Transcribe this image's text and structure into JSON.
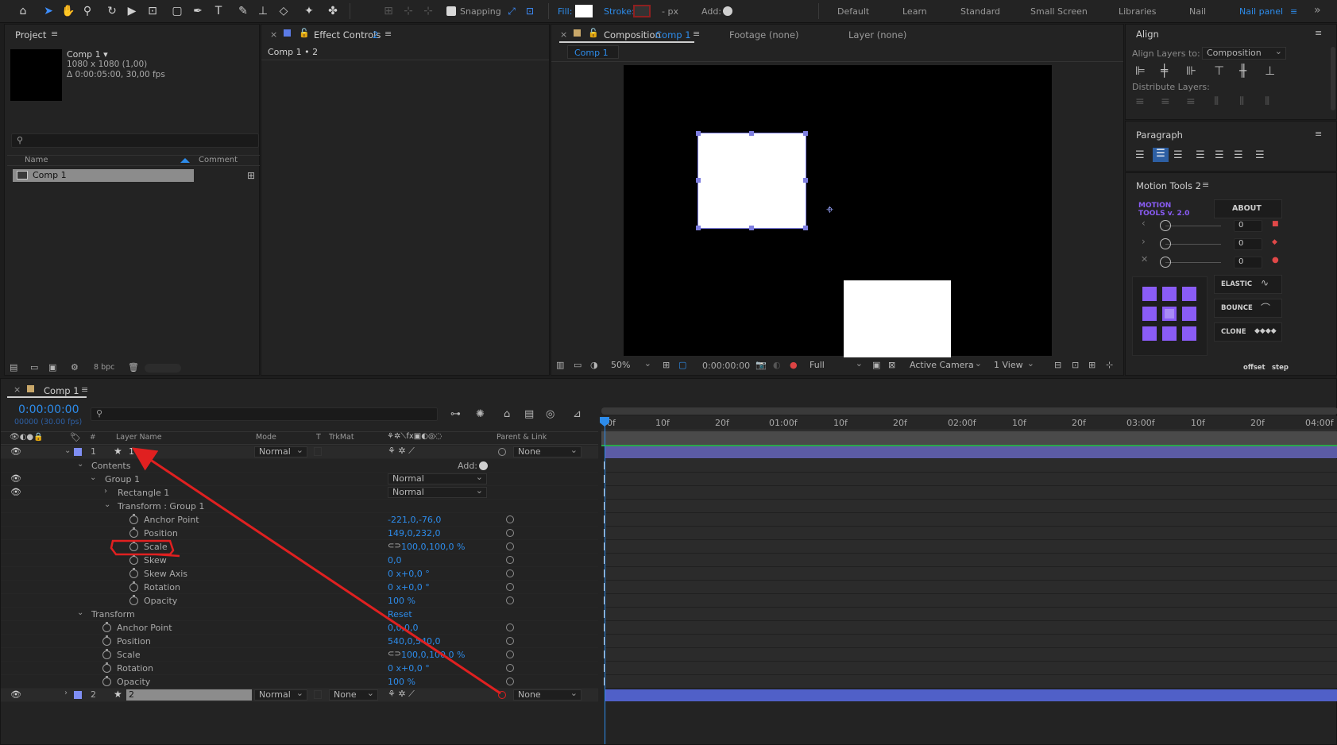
{
  "toolbar": {
    "snapping": "Snapping",
    "fill": "Fill:",
    "stroke": "Stroke:",
    "px": "- px",
    "add": "Add:",
    "workspaces": [
      "Default",
      "Learn",
      "Standard",
      "Small Screen",
      "Libraries",
      "Nail",
      "Nail panel"
    ],
    "more": "»"
  },
  "project": {
    "title": "Project",
    "comp_name": "Comp 1 ▾",
    "comp_size": "1080 x 1080 (1,00)",
    "comp_duration": "Δ 0:00:05:00, 30,00 fps",
    "search_placeholder": "",
    "col_name": "Name",
    "col_comment": "Comment",
    "item": "Comp 1",
    "bpc": "8 bpc"
  },
  "effects": {
    "title": "Effect Controls",
    "num": "2",
    "sub": "Comp 1 • 2"
  },
  "composition": {
    "tab_label": "Composition",
    "tab_name": "Comp 1",
    "footage": "Footage (none)",
    "layer": "Layer (none)",
    "subtab": "Comp 1",
    "zoom": "50%",
    "timecode": "0:00:00:00",
    "resolution": "Full",
    "camera": "Active Camera",
    "views": "1 View"
  },
  "align": {
    "title": "Align",
    "align_to_label": "Align Layers to:",
    "align_to_value": "Composition",
    "distribute": "Distribute Layers:"
  },
  "paragraph": {
    "title": "Paragraph"
  },
  "motion_tools": {
    "title": "Motion Tools 2",
    "brand1": "MOTION",
    "brand2": "TOOLS v. 2.0",
    "about": "ABOUT",
    "sliders": [
      "0",
      "0",
      "0"
    ],
    "elastic": "ELASTIC",
    "bounce": "BOUNCE",
    "clone": "CLONE",
    "offset": "offset",
    "step": "step",
    "accent": "#8a5cf6"
  },
  "timeline": {
    "tab": "Comp 1",
    "timecode": "0:00:00:00",
    "timecode_sub": "00000 (30.00 fps)",
    "headers": {
      "layer_name": "Layer Name",
      "mode": "Mode",
      "t": "T",
      "trkmat": "TrkMat",
      "parent": "Parent & Link"
    },
    "ruler": [
      "0f",
      "10f",
      "20f",
      "01:00f",
      "10f",
      "20f",
      "02:00f",
      "10f",
      "20f",
      "03:00f",
      "10f",
      "20f",
      "04:00f"
    ],
    "layer1": {
      "num": "1",
      "name": "1",
      "mode": "Normal",
      "parent": "None"
    },
    "contents": "Contents",
    "add": "Add:",
    "group": "Group 1",
    "group_mode": "Normal",
    "rect": "Rectangle 1",
    "rect_mode": "Normal",
    "transform_group": "Transform : Group 1",
    "group_props": [
      {
        "name": "Anchor Point",
        "value": "-221,0,-76,0"
      },
      {
        "name": "Position",
        "value": "149,0,232,0"
      },
      {
        "name": "Scale",
        "value": "100,0,100,0 %"
      },
      {
        "name": "Skew",
        "value": "0,0"
      },
      {
        "name": "Skew Axis",
        "value": "0 x+0,0 °"
      },
      {
        "name": "Rotation",
        "value": "0 x+0,0 °"
      },
      {
        "name": "Opacity",
        "value": "100 %"
      }
    ],
    "transform": "Transform",
    "reset": "Reset",
    "layer_props": [
      {
        "name": "Anchor Point",
        "value": "0,0,0,0"
      },
      {
        "name": "Position",
        "value": "540,0,540,0"
      },
      {
        "name": "Scale",
        "value": "100,0,100,0 %"
      },
      {
        "name": "Rotation",
        "value": "0 x+0,0 °"
      },
      {
        "name": "Opacity",
        "value": "100 %"
      }
    ],
    "layer2": {
      "num": "2",
      "name": "2",
      "mode": "Normal",
      "trkmat": "None",
      "parent": "None"
    }
  }
}
